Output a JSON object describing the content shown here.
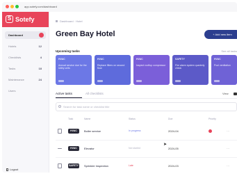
{
  "browser": {
    "url": "app.sotefy.com/dashboard"
  },
  "brand": {
    "name": "Sotefy",
    "icon": "sotefy-logo-icon",
    "accent": "#e8445a"
  },
  "sidebar": {
    "items": [
      {
        "label": "Dashboard",
        "count": "",
        "active": true
      },
      {
        "label": "Hotels",
        "count": "12"
      },
      {
        "label": "Checklists",
        "count": "4"
      },
      {
        "label": "Tasks",
        "count": "18"
      },
      {
        "label": "Maintenance",
        "count": "24"
      },
      {
        "label": "Users",
        "count": ""
      }
    ],
    "logout": "Logout"
  },
  "header": {
    "breadcrumb": "Dashboard · Hotel",
    "title": "Green Bay Hotel",
    "add_button": "+ Add new item"
  },
  "tasks": {
    "heading": "Upcoming tasks",
    "see_all": "See all tasks",
    "cards": [
      {
        "kind": "HVAC",
        "text": "Annual service due for the lobby units",
        "color": "#6c78e6"
      },
      {
        "kind": "HVAC",
        "text": "Replace filters on second floor",
        "color": "#5e6bdc"
      },
      {
        "kind": "HVAC",
        "text": "Inspect rooftop compressor",
        "color": "#7b5fd9"
      },
      {
        "kind": "SAFETY",
        "text": "Fire alarm system quarterly check",
        "color": "#5c5ac8"
      },
      {
        "kind": "HVAC",
        "text": "Pool ventilation",
        "color": "#6f62d6"
      }
    ]
  },
  "tabs": [
    {
      "label": "Active tasks",
      "active": true
    },
    {
      "label": "All checklists",
      "active": false
    }
  ],
  "view_label": "View",
  "search": {
    "placeholder": "Search for task name or checklist title"
  },
  "table": {
    "headers": [
      "Task",
      "Name",
      "Status",
      "Due",
      "Priority"
    ],
    "rows": [
      {
        "tag": "HVAC",
        "name": "Boiler service",
        "status": "In progress",
        "status_color": "#6c78e6",
        "due": "2024-04",
        "flag": true
      },
      {
        "tag": "HVAC",
        "name": "Elevator",
        "status": "Not started",
        "status_color": "#b0b0c0",
        "due": "2024-05",
        "flag": false
      },
      {
        "tag": "SAFETY",
        "name": "Sprinkler inspection",
        "status": "Late",
        "status_color": "#e8445a",
        "due": "2024-03",
        "flag": false
      }
    ]
  }
}
